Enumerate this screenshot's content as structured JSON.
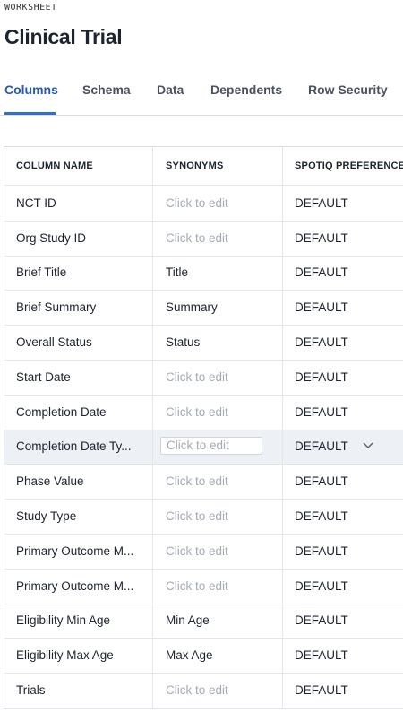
{
  "header": {
    "eyebrow": "WORKSHEET",
    "title": "Clinical Trial"
  },
  "tabs": [
    {
      "label": "Columns",
      "active": true
    },
    {
      "label": "Schema",
      "active": false
    },
    {
      "label": "Data",
      "active": false
    },
    {
      "label": "Dependents",
      "active": false
    },
    {
      "label": "Row Security",
      "active": false
    }
  ],
  "table": {
    "headers": [
      "COLUMN NAME",
      "SYNONYMS",
      "SPOTIQ PREFERENCE"
    ],
    "rows": [
      {
        "name": "NCT ID",
        "synonym": "Click to edit",
        "placeholder": true,
        "pref": "DEFAULT"
      },
      {
        "name": "Org Study ID",
        "synonym": "Click to edit",
        "placeholder": true,
        "pref": "DEFAULT"
      },
      {
        "name": "Brief Title",
        "synonym": "Title",
        "placeholder": false,
        "pref": "DEFAULT"
      },
      {
        "name": "Brief Summary",
        "synonym": "Summary",
        "placeholder": false,
        "pref": "DEFAULT"
      },
      {
        "name": "Overall Status",
        "synonym": "Status",
        "placeholder": false,
        "pref": "DEFAULT"
      },
      {
        "name": "Start Date",
        "synonym": "Click to edit",
        "placeholder": true,
        "pref": "DEFAULT"
      },
      {
        "name": "Completion Date",
        "synonym": "Click to edit",
        "placeholder": true,
        "pref": "DEFAULT"
      },
      {
        "name": "Completion Date Ty...",
        "synonym": "Click to edit",
        "placeholder": true,
        "pref": "DEFAULT",
        "selected": true
      },
      {
        "name": "Phase Value",
        "synonym": "Click to edit",
        "placeholder": true,
        "pref": "DEFAULT"
      },
      {
        "name": "Study Type",
        "synonym": "Click to edit",
        "placeholder": true,
        "pref": "DEFAULT"
      },
      {
        "name": "Primary Outcome M...",
        "synonym": "Click to edit",
        "placeholder": true,
        "pref": "DEFAULT"
      },
      {
        "name": "Primary Outcome M...",
        "synonym": "Click to edit",
        "placeholder": true,
        "pref": "DEFAULT"
      },
      {
        "name": "Eligibility Min Age",
        "synonym": "Min Age",
        "placeholder": false,
        "pref": "DEFAULT"
      },
      {
        "name": "Eligibility Max Age",
        "synonym": "Max Age",
        "placeholder": false,
        "pref": "DEFAULT"
      },
      {
        "name": "Trials",
        "synonym": "Click to edit",
        "placeholder": true,
        "pref": "DEFAULT"
      }
    ]
  }
}
